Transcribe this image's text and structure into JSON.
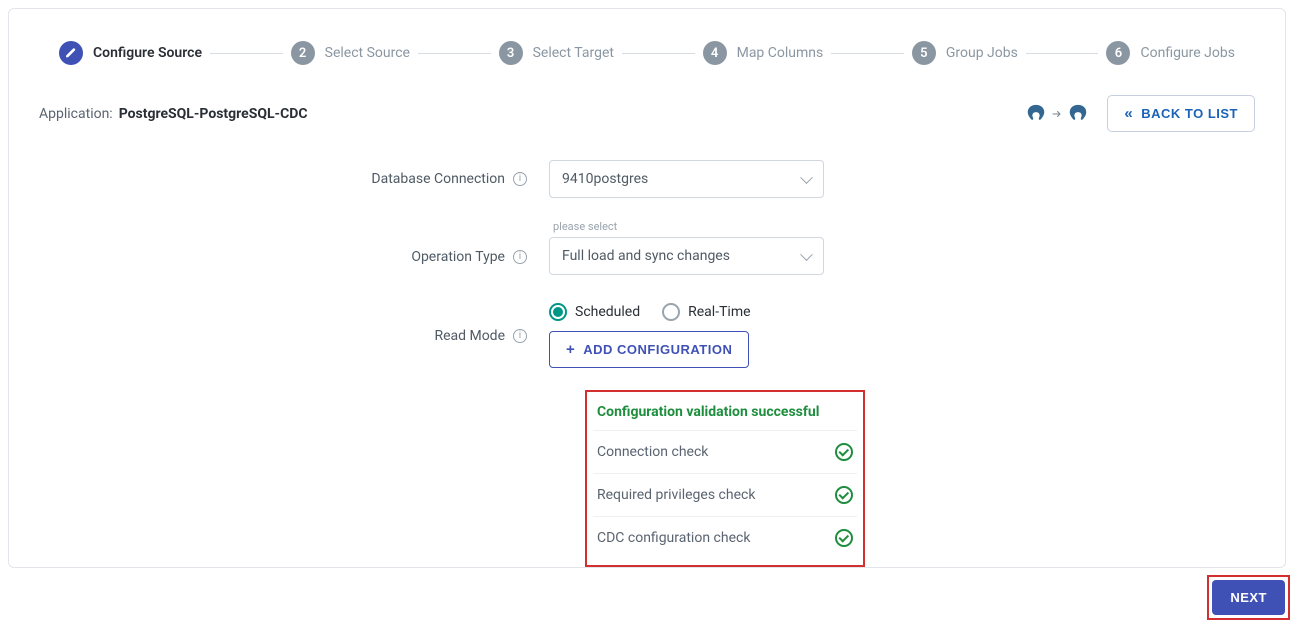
{
  "stepper": [
    {
      "num": "",
      "label": "Configure Source",
      "active": true,
      "icon": "pencil"
    },
    {
      "num": "2",
      "label": "Select Source",
      "active": false
    },
    {
      "num": "3",
      "label": "Select Target",
      "active": false
    },
    {
      "num": "4",
      "label": "Map Columns",
      "active": false
    },
    {
      "num": "5",
      "label": "Group Jobs",
      "active": false
    },
    {
      "num": "6",
      "label": "Configure Jobs",
      "active": false
    }
  ],
  "app": {
    "label": "Application:",
    "name": "PostgreSQL-PostgreSQL-CDC"
  },
  "back_button": "BACK TO LIST",
  "form": {
    "db_conn_label": "Database Connection",
    "db_conn_value": "9410postgres",
    "op_type_label": "Operation Type",
    "op_type_hint": "please select",
    "op_type_value": "Full load and sync changes",
    "read_mode_label": "Read Mode",
    "read_mode_options": {
      "scheduled": "Scheduled",
      "realtime": "Real-Time"
    },
    "read_mode_selected": "scheduled",
    "add_config": "ADD CONFIGURATION"
  },
  "validation": {
    "title": "Configuration validation successful",
    "checks": [
      "Connection check",
      "Required privileges check",
      "CDC configuration check"
    ]
  },
  "next_button": "NEXT",
  "colors": {
    "accent": "#3f51b5",
    "success": "#1e8e3e",
    "highlight_border": "#d32f2f"
  }
}
